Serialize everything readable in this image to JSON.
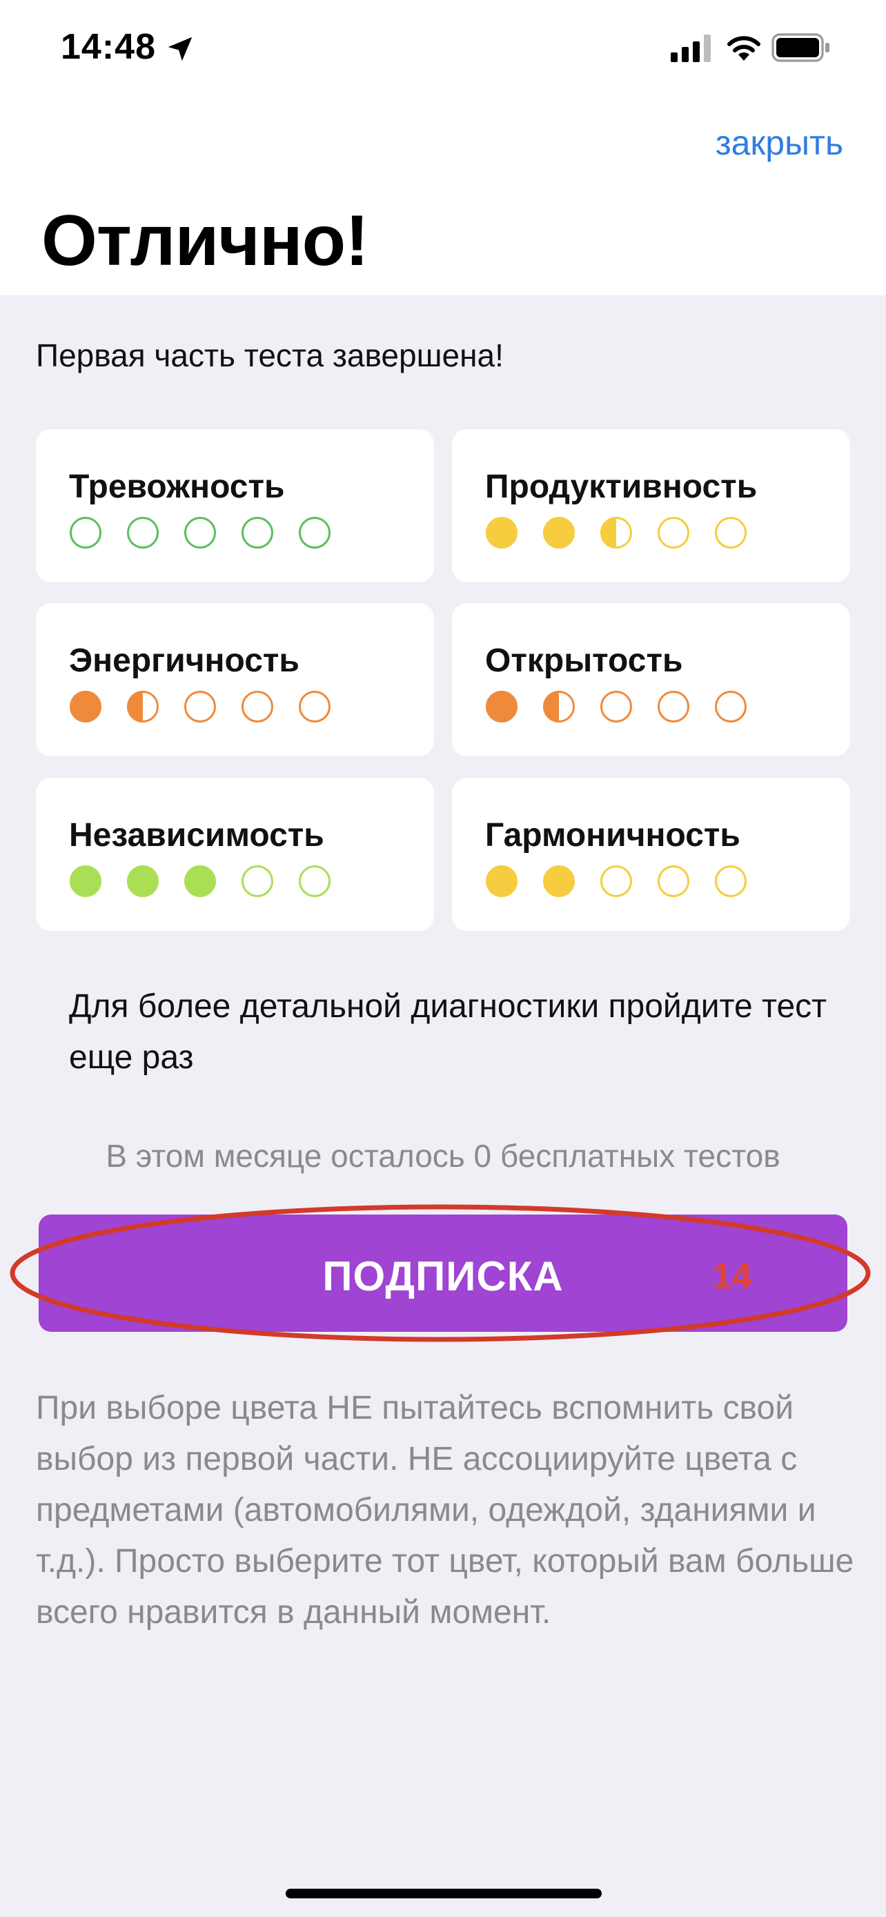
{
  "status_bar": {
    "time": "14:48"
  },
  "header": {
    "close_label": "закрыть",
    "title": "Отлично!"
  },
  "subtitle": "Первая часть теста завершена!",
  "traits": [
    {
      "label": "Тревожность",
      "color": "#5cbf5c",
      "level": 0
    },
    {
      "label": "Продуктивность",
      "color": "#f6cd3e",
      "level": 2.5
    },
    {
      "label": "Энергичность",
      "color": "#ef8a3c",
      "level": 1.5
    },
    {
      "label": "Открытость",
      "color": "#ef8a3c",
      "level": 1.5
    },
    {
      "label": "Независимость",
      "color": "#aadf55",
      "level": 3
    },
    {
      "label": "Гармоничность",
      "color": "#f6cd3e",
      "level": 2
    }
  ],
  "info_text": "Для более детальной диагностики пройдите тест еще раз",
  "quota_text": "В этом месяце осталось 0 бесплатных тестов",
  "subscribe": {
    "label": "ПОДПИСКА",
    "annotation_number": "14"
  },
  "hint_text": "При выборе цвета НЕ пытайтесь вспомнить свой выбор из первой части. НЕ ассоциируйте цвета с предметами (автомобилями, одеждой, зданиями и т.д.). Просто выберите тот цвет, который вам больше всего нравится в данный момент.",
  "colors": {
    "accent": "#9f44d3",
    "link": "#2f7de1",
    "annotation": "#d23a2a"
  }
}
